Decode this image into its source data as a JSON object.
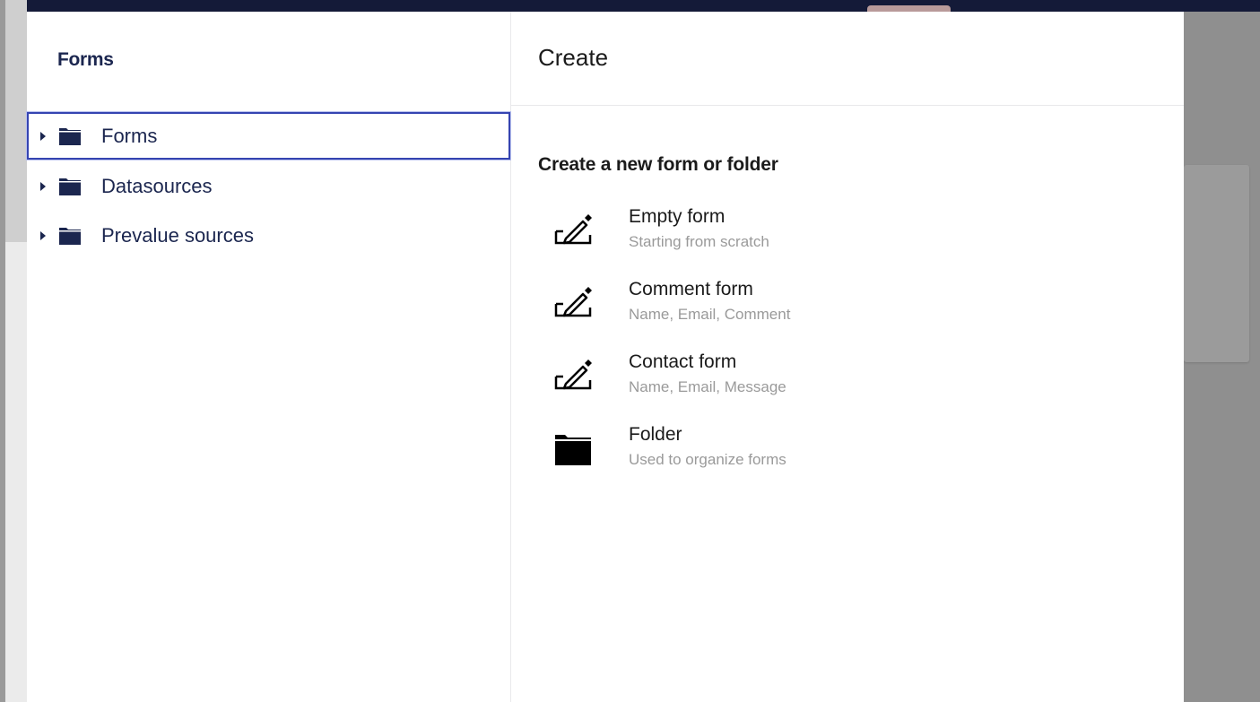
{
  "tree": {
    "title": "Forms",
    "items": [
      {
        "label": "Forms",
        "icon": "folder-icon",
        "selected": true
      },
      {
        "label": "Datasources",
        "icon": "folder-icon",
        "selected": false
      },
      {
        "label": "Prevalue sources",
        "icon": "folder-icon",
        "selected": false
      }
    ]
  },
  "create": {
    "title": "Create",
    "section_title": "Create a new form or folder",
    "options": [
      {
        "name": "Empty form",
        "description": "Starting from scratch",
        "icon": "edit-icon"
      },
      {
        "name": "Comment form",
        "description": "Name, Email, Comment",
        "icon": "edit-icon"
      },
      {
        "name": "Contact form",
        "description": "Name, Email, Message",
        "icon": "edit-icon"
      },
      {
        "name": "Folder",
        "description": "Used to organize forms",
        "icon": "folder-icon"
      }
    ]
  },
  "colors": {
    "topbar": "#141a38",
    "tree_text": "#1b264f",
    "selection_border": "#3544b1",
    "muted_text": "#9a9a9a"
  }
}
